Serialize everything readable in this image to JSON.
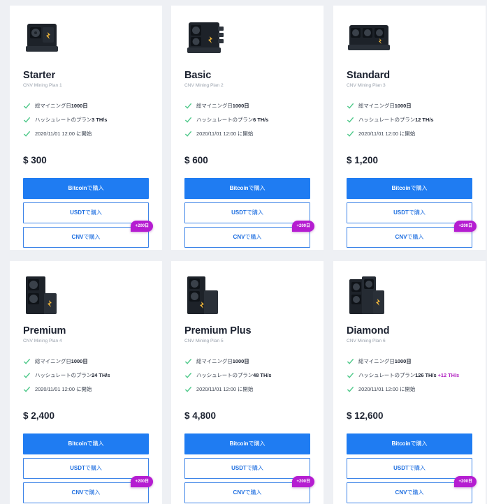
{
  "accent": "#1f7cf2",
  "badge_color": "#b51dd1",
  "check_color": "#4fc98a",
  "plans": [
    {
      "name": "Starter",
      "subtitle": "CNV Mining Plan 1",
      "image": "mining-rig-1fan",
      "f1_label": "総マイニング日 ",
      "f1_value": "1000日",
      "f2_label": "ハッシュレートのプラン ",
      "f2_value": "3 TH/s",
      "f2_bonus": "",
      "f3_label": "2020/11/01 12:00 に開始",
      "price": "$ 300",
      "btn1_bold": "Bitcoin",
      "btn2_bold": "USDT",
      "btn3_bold": "CNV",
      "buy_suffix": "で購入",
      "badge": "+200日"
    },
    {
      "name": "Basic",
      "subtitle": "CNV Mining Plan 2",
      "image": "mining-rig-2fan",
      "f1_label": "総マイニング日 ",
      "f1_value": "1000日",
      "f2_label": "ハッシュレートのプラン ",
      "f2_value": "6 TH/s",
      "f2_bonus": "",
      "f3_label": "2020/11/01 12:00 に開始",
      "price": "$ 600",
      "btn1_bold": "Bitcoin",
      "btn2_bold": "USDT",
      "btn3_bold": "CNV",
      "buy_suffix": "で購入",
      "badge": "+200日"
    },
    {
      "name": "Standard",
      "subtitle": "CNV Mining Plan 3",
      "image": "mining-rig-3fan",
      "f1_label": "総マイニング日 ",
      "f1_value": "1000日",
      "f2_label": "ハッシュレートのプラン ",
      "f2_value": "12 TH/s",
      "f2_bonus": "",
      "f3_label": "2020/11/01 12:00 に開始",
      "price": "$ 1,200",
      "btn1_bold": "Bitcoin",
      "btn2_bold": "USDT",
      "btn3_bold": "CNV",
      "buy_suffix": "で購入",
      "badge": "+200日"
    },
    {
      "name": "Premium",
      "subtitle": "CNV Mining Plan 4",
      "image": "mining-rig-tower",
      "f1_label": "総マイニング日 ",
      "f1_value": "1000日",
      "f2_label": "ハッシュレートのプラン ",
      "f2_value": "24 TH/s",
      "f2_bonus": "",
      "f3_label": "2020/11/01 12:00 に開始",
      "price": "$ 2,400",
      "btn1_bold": "Bitcoin",
      "btn2_bold": "USDT",
      "btn3_bold": "CNV",
      "buy_suffix": "で購入",
      "badge": "+200日"
    },
    {
      "name": "Premium Plus",
      "subtitle": "CNV Mining Plan 5",
      "image": "mining-rig-tower",
      "f1_label": "総マイニング日 ",
      "f1_value": "1000日",
      "f2_label": "ハッシュレートのプラン ",
      "f2_value": "48 TH/s",
      "f2_bonus": "",
      "f3_label": "2020/11/01 12:00 に開始",
      "price": "$ 4,800",
      "btn1_bold": "Bitcoin",
      "btn2_bold": "USDT",
      "btn3_bold": "CNV",
      "buy_suffix": "で購入",
      "badge": "+200日"
    },
    {
      "name": "Diamond",
      "subtitle": "CNV Mining Plan 6",
      "image": "mining-rig-cluster",
      "f1_label": "総マイニング日 ",
      "f1_value": "1000日",
      "f2_label": "ハッシュレートのプラン ",
      "f2_value": "126 TH/s",
      "f2_bonus": "+12 TH/s",
      "f3_label": "2020/11/01 12:00 に開始",
      "price": "$ 12,600",
      "btn1_bold": "Bitcoin",
      "btn2_bold": "USDT",
      "btn3_bold": "CNV",
      "buy_suffix": "で購入",
      "badge": "+200日"
    }
  ]
}
